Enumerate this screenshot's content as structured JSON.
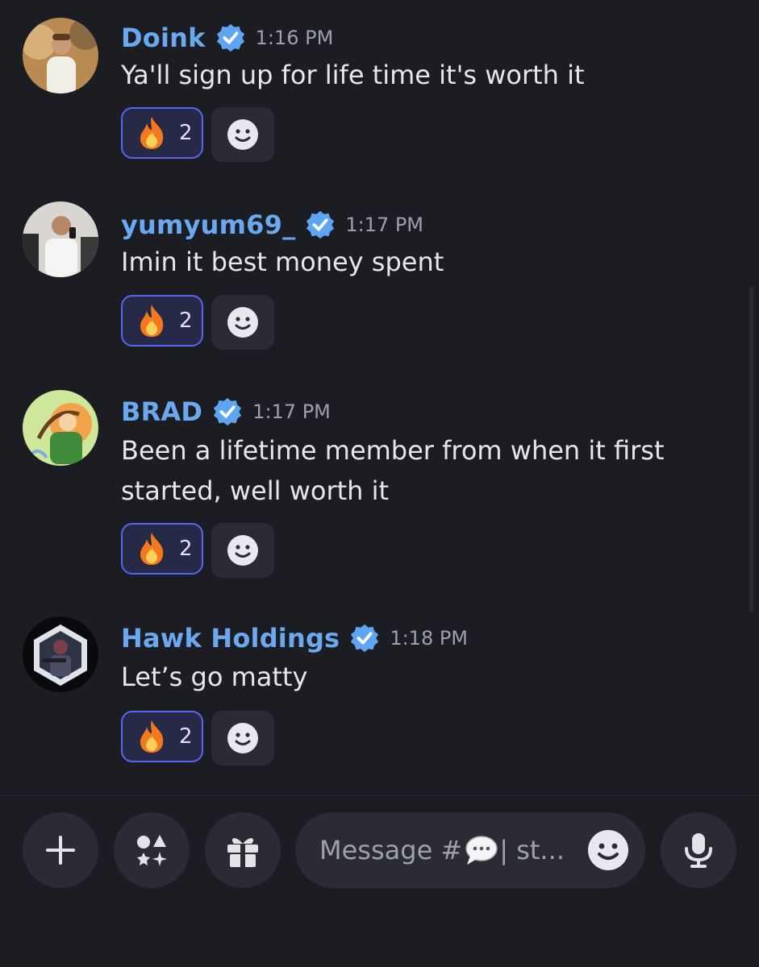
{
  "messages": [
    {
      "username": "Doink",
      "time": "1:16 PM",
      "text": "Ya'll sign up for life time it's worth it",
      "reaction": {
        "emoji": "fire",
        "count": "2"
      }
    },
    {
      "username": "yumyum69_",
      "time": "1:17 PM",
      "text": "Imin it best money spent",
      "reaction": {
        "emoji": "fire",
        "count": "2"
      }
    },
    {
      "username": "BRAD",
      "time": "1:17 PM",
      "text": "Been a lifetime member from when it first started, well worth it",
      "reaction": {
        "emoji": "fire",
        "count": "2"
      }
    },
    {
      "username": "Hawk Holdings",
      "time": "1:18 PM",
      "text": "Let’s go matty",
      "reaction": {
        "emoji": "fire",
        "count": "2"
      }
    }
  ],
  "composer": {
    "placeholder_prefix": "Message #",
    "placeholder_suffix": " | st...",
    "icons": [
      "plus-icon",
      "apps-icon",
      "gift-icon",
      "emoji-icon",
      "microphone-icon"
    ]
  },
  "colors": {
    "background": "#1c1d23",
    "username": "#6aa8f0",
    "verified": "#5ea5f2",
    "reaction_border": "#5865f2",
    "reaction_bg": "#262a46"
  }
}
